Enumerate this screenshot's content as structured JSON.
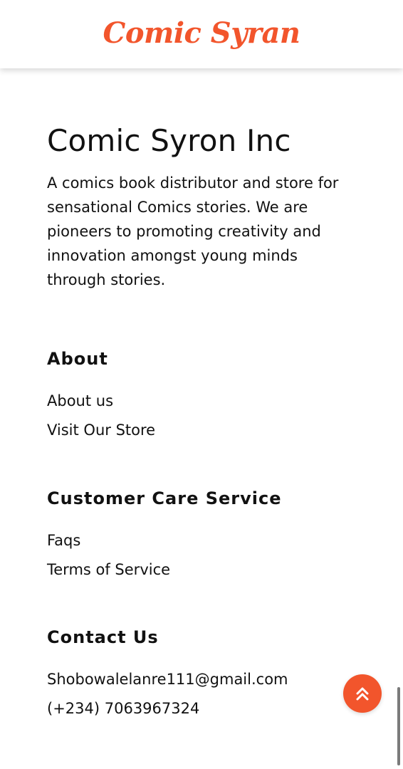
{
  "header": {
    "logo_text": "Comic Syran"
  },
  "brand": {
    "title": "Comic Syron Inc",
    "description": "A comics book distributor and store for sensational Comics stories. We are pioneers to promoting creativity and innovation amongst young minds through stories."
  },
  "about": {
    "title": "About",
    "links": [
      "About us",
      "Visit Our Store"
    ]
  },
  "customer_care": {
    "title": "Customer Care Service",
    "links": [
      "Faqs",
      "Terms of Service"
    ]
  },
  "contact": {
    "title": "Contact Us",
    "email": "Shobowalelanre111@gmail.com",
    "phone": "(+234) 7063967324"
  },
  "scroll_top": {
    "icon": "double-chevron-up-icon"
  },
  "colors": {
    "accent": "#f2552c",
    "text": "#111111",
    "background": "#ffffff"
  }
}
